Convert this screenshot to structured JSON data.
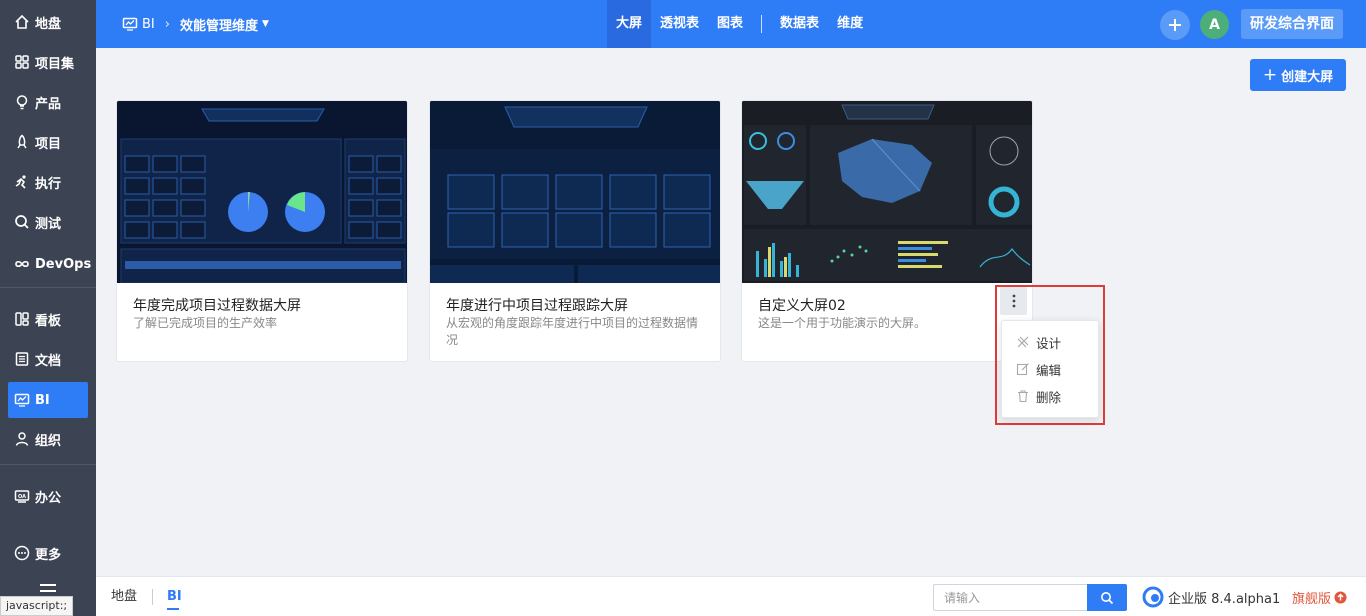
{
  "sidebar": {
    "items": [
      {
        "label": "地盘",
        "icon": "home-icon"
      },
      {
        "label": "项目集",
        "icon": "grid-icon"
      },
      {
        "label": "产品",
        "icon": "bulb-icon"
      },
      {
        "label": "项目",
        "icon": "rocket-icon"
      },
      {
        "label": "执行",
        "icon": "run-icon"
      },
      {
        "label": "测试",
        "icon": "test-icon"
      },
      {
        "label": "DevOps",
        "icon": "infinity-icon"
      },
      {
        "label": "看板",
        "icon": "kanban-icon"
      },
      {
        "label": "文档",
        "icon": "doc-icon"
      },
      {
        "label": "BI",
        "icon": "monitor-icon",
        "active": true
      },
      {
        "label": "组织",
        "icon": "people-icon"
      },
      {
        "label": "办公",
        "icon": "office-icon"
      },
      {
        "label": "更多",
        "icon": "more-icon"
      }
    ]
  },
  "header": {
    "breadcrumb_module": "BI",
    "breadcrumb_dimension": "效能管理维度",
    "tabs": [
      "大屏",
      "透视表",
      "图表"
    ],
    "tabs2": [
      "数据表",
      "维度"
    ],
    "avatar_initial": "A",
    "team_label": "研发综合界面"
  },
  "create_button": "创建大屏",
  "cards": [
    {
      "title": "年度完成项目过程数据大屏",
      "desc": "了解已完成项目的生产效率"
    },
    {
      "title": "年度进行中项目过程跟踪大屏",
      "desc": "从宏观的角度跟踪年度进行中项目的过程数据情况"
    },
    {
      "title": "自定义大屏02",
      "desc": "这是一个用于功能演示的大屏。"
    }
  ],
  "menu": {
    "design": "设计",
    "edit": "编辑",
    "delete": "删除"
  },
  "footer": {
    "tab_home": "地盘",
    "tab_bi": "BI",
    "search_placeholder": "请输入",
    "version": "企业版 8.4.alpha1",
    "flagship": "旗舰版"
  },
  "status_tip": "javascript:;",
  "colors": {
    "accent": "#2e7cf6",
    "sidebar": "#3c4353",
    "highlight": "#e03b3b"
  }
}
